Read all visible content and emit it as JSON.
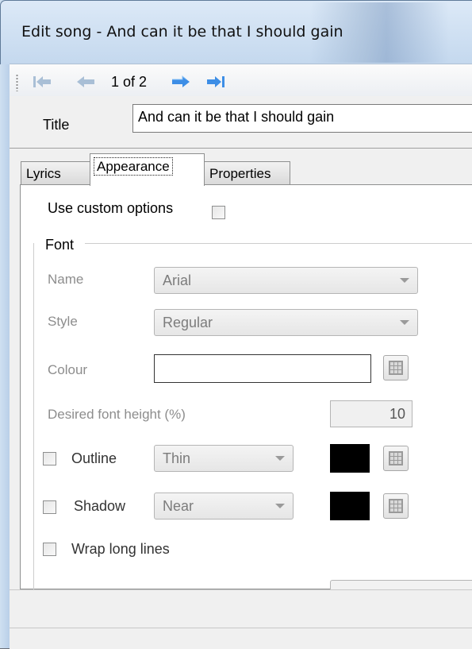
{
  "window": {
    "title": "Edit song - And can it be that I should gain"
  },
  "toolbar": {
    "page_indicator": "1 of 2",
    "first_icon": "first-record-icon",
    "prev_icon": "previous-arrow-icon",
    "next_icon": "next-arrow-icon",
    "last_icon": "last-record-icon"
  },
  "song": {
    "title_label": "Title",
    "title_value": "And can it be that I should gain"
  },
  "tabs": [
    {
      "label": "Lyrics"
    },
    {
      "label": "Appearance"
    },
    {
      "label": "Properties"
    }
  ],
  "active_tab": "Appearance",
  "appearance": {
    "use_custom_label": "Use custom options",
    "use_custom_checked": false,
    "font_group_label": "Font",
    "name_label": "Name",
    "name_value": "Arial",
    "style_label": "Style",
    "style_value": "Regular",
    "colour_label": "Colour",
    "colour_value": "#ffffff",
    "height_label": "Desired font height (%)",
    "height_value": "10",
    "outline_label": "Outline",
    "outline_checked": false,
    "outline_value": "Thin",
    "outline_colour": "#000000",
    "shadow_label": "Shadow",
    "shadow_checked": false,
    "shadow_value": "Near",
    "shadow_colour": "#000000",
    "wrap_label": "Wrap long lines",
    "wrap_checked": false
  },
  "colors": {
    "accent_arrow": "#3d8ee6",
    "disabled_arrow": "#a9bfd6",
    "disabled_text": "#8d8d8d"
  }
}
